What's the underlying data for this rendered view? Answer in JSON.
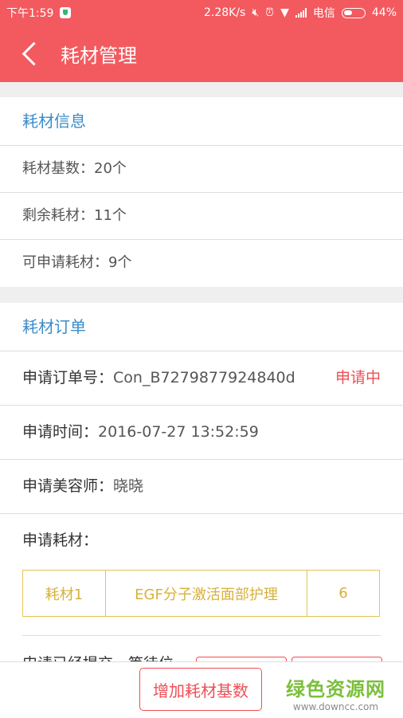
{
  "status_bar": {
    "time": "下午1:59",
    "speed": "2.28K/s",
    "carrier": "电信",
    "battery": "44%",
    "battery_level": 0.44
  },
  "header": {
    "title": "耗材管理"
  },
  "info_section": {
    "heading": "耗材信息",
    "rows": [
      "耗材基数：20个",
      "剩余耗材：11个",
      "可申请耗材：9个"
    ]
  },
  "order_section": {
    "heading": "耗材订单",
    "order_no_label": "申请订单号：",
    "order_no": "Con_B7279877924840d",
    "status": "申请中",
    "time_label": "申请时间：",
    "time": "2016-07-27 13:52:59",
    "beautician_label": "申请美容师：",
    "beautician": "晓晓",
    "materials_label": "申请耗材：",
    "materials": [
      {
        "name": "耗材1",
        "desc": "EGF分子激活面部护理",
        "qty": "6"
      }
    ],
    "partial_text": "申请已经提交，等待位"
  },
  "bottom": {
    "add_button": "增加耗材基数",
    "watermark_title": "绿色资源网",
    "watermark_url": "www.downcc.com"
  },
  "colors": {
    "primary": "#f35a5f",
    "accent_blue": "#3c8dc8",
    "gold": "#d8b13a"
  }
}
